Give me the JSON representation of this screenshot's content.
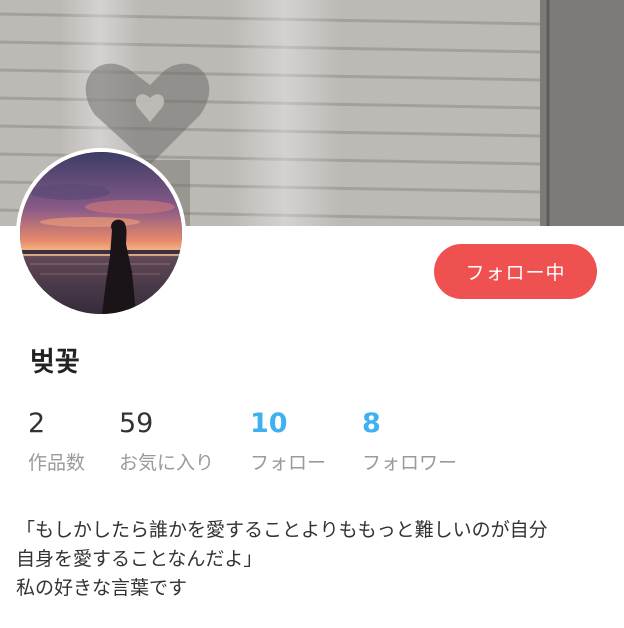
{
  "header": {
    "cover_image": "window-blinds-heart-shadow-photo",
    "avatar_image": "sunset-beach-silhouette-photo"
  },
  "profile": {
    "username": "벚꽃",
    "follow_button_label": "フォロー中"
  },
  "stats": [
    {
      "value": "2",
      "label": "作品数"
    },
    {
      "value": "59",
      "label": "お気に入り"
    },
    {
      "value": "10",
      "label": "フォロー"
    },
    {
      "value": "8",
      "label": "フォロワー"
    }
  ],
  "bio": {
    "lines": [
      "「もしかしたら誰かを愛することよりももっと難しいのが自分",
      "自身を愛することなんだよ」",
      "私の好きな言葉です"
    ]
  },
  "colors": {
    "follow_button": "#ef5050",
    "stat_accent": "#3fb1f0",
    "label_gray": "#9a9a9a"
  }
}
